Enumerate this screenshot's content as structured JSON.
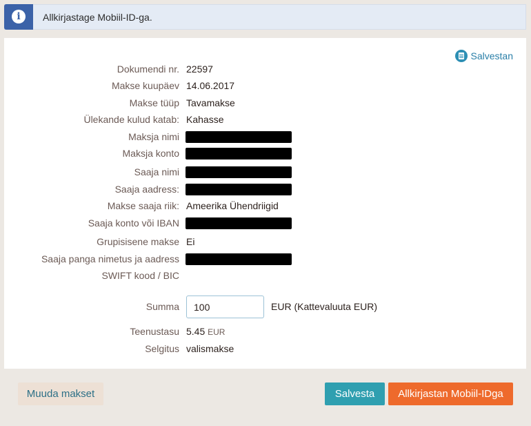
{
  "banner": {
    "icon": "info-icon",
    "icon_glyph": "i",
    "text": "Allkirjastage Mobiil-ID-ga."
  },
  "actions": {
    "save_link_label": "Salvestan",
    "save_link_icon": "document-icon"
  },
  "fields": {
    "document_no": {
      "label": "Dokumendi nr.",
      "value": "22597"
    },
    "payment_date": {
      "label": "Makse kuupäev",
      "value": "14.06.2017"
    },
    "payment_type": {
      "label": "Makse tüüp",
      "value": "Tavamakse"
    },
    "transfer_fees": {
      "label": "Ülekande kulud katab:",
      "value": "Kahasse"
    },
    "payer_name": {
      "label": "Maksja nimi"
    },
    "payer_account": {
      "label": "Maksja konto"
    },
    "recipient_name": {
      "label": "Saaja nimi"
    },
    "recipient_address": {
      "label": "Saaja aadress:"
    },
    "recipient_country": {
      "label": "Makse saaja riik:",
      "value": "Ameerika Ühendriigid"
    },
    "recipient_iban": {
      "label": "Saaja konto või IBAN"
    },
    "intragroup": {
      "label": "Grupisisene makse",
      "value": "Ei"
    },
    "bank_name_address": {
      "label": "Saaja panga nimetus ja aadress"
    },
    "swift": {
      "label": "SWIFT kood / BIC"
    },
    "amount": {
      "label": "Summa",
      "value": "100",
      "suffix": "EUR (Kattevaluuta EUR)"
    },
    "service_fee": {
      "label": "Teenustasu",
      "value": "5.45",
      "currency": "EUR"
    },
    "explanation": {
      "label": "Selgitus",
      "value": "valismakse"
    }
  },
  "footer": {
    "change_label": "Muuda makset",
    "save_label": "Salvesta",
    "sign_label": "Allkirjastan Mobiil-IDga"
  },
  "colors": {
    "banner_icon_bg": "#3b62a8",
    "primary_button": "#2f9fb0",
    "sign_button": "#ee6a2c",
    "secondary_button": "#ede0d5",
    "link": "#2a7fa8"
  }
}
